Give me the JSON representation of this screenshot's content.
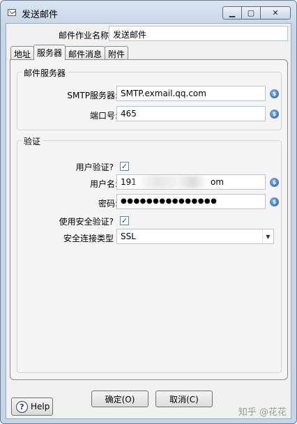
{
  "window": {
    "title": "发送邮件",
    "minimize_glyph": "▁",
    "maximize_glyph": "▢",
    "close_glyph": "✕"
  },
  "job": {
    "label": "邮件作业名称:",
    "value": "发送邮件"
  },
  "tabs": [
    {
      "label": "地址"
    },
    {
      "label": "服务器"
    },
    {
      "label": "邮件消息"
    },
    {
      "label": "附件"
    }
  ],
  "mail_server": {
    "group_title": "邮件服务器",
    "smtp_label": "SMTP服务器:",
    "smtp_value": "SMTP.exmail.qq.com",
    "port_label": "端口号:",
    "port_value": "465"
  },
  "auth": {
    "group_title": "验证",
    "user_auth_label": "用户验证?",
    "user_auth_checked": true,
    "username_label": "用户名:",
    "username_visible_start": "191",
    "username_visible_end": "om",
    "password_label": "密码:",
    "password_value": "●●●●●●●●●●●●●●●",
    "secure_auth_label": "使用安全验证?",
    "secure_auth_checked": true,
    "conn_type_label": "安全连接类型",
    "conn_type_value": "SSL"
  },
  "footer": {
    "help": "Help",
    "ok": "确定(O)",
    "cancel": "取消(C)",
    "watermark": "知乎 @花花"
  },
  "icons": {
    "variable": "$",
    "check": "✓",
    "dropdown": "▼",
    "help": "?"
  }
}
